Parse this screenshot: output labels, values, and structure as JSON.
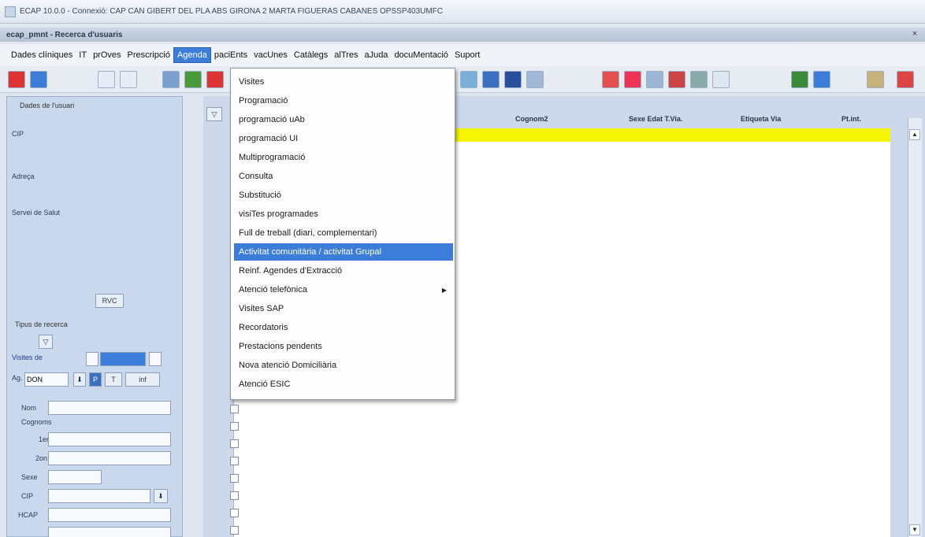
{
  "window": {
    "title": "ECAP 10.0.0 - Connexió: CAP CAN GIBERT DEL PLA    ABS GIRONA 2 MARTA FIGUERAS CABANES OPSSP403UMFC",
    "subtitle": "ecap_pmnt - Recerca d'usuaris",
    "close": "×"
  },
  "menubar": [
    {
      "label": "Dades clíniques"
    },
    {
      "label": "IT"
    },
    {
      "label": "prOves"
    },
    {
      "label": "Prescripció"
    },
    {
      "label": "Agenda",
      "active": true
    },
    {
      "label": "paciEnts"
    },
    {
      "label": "vacUnes"
    },
    {
      "label": "Catàlegs"
    },
    {
      "label": "alTres"
    },
    {
      "label": "aJuda"
    },
    {
      "label": "docuMentació"
    },
    {
      "label": "Suport"
    }
  ],
  "dropdown": {
    "items": [
      {
        "label": "Visites"
      },
      {
        "label": "Programació"
      },
      {
        "label": "programació uAb"
      },
      {
        "label": "programació UI"
      },
      {
        "label": "Multiprogramació"
      },
      {
        "label": "Consulta"
      },
      {
        "label": "Substitució"
      },
      {
        "label": "visiTes programades"
      },
      {
        "label": "Full de treball (diari, complementari)"
      },
      {
        "label": "Activitat comunitària / activitat Grupal",
        "selected": true
      },
      {
        "label": "Reinf. Agendes d'Extracció"
      },
      {
        "label": "Atenció telefònica",
        "submenu": true
      },
      {
        "label": "Visites SAP"
      },
      {
        "label": "Recordatoris"
      },
      {
        "label": "Prestacions pendents"
      },
      {
        "label": "Nova atenció Domiciliària"
      },
      {
        "label": "Atenció ESIC"
      }
    ]
  },
  "left_panel": {
    "group_user": "Dades de l'usuari",
    "cip_label": "CIP",
    "address_label": "Adreça",
    "health_service_label": "Servei de Salut",
    "rvc_button": "RVC",
    "group_search": "Tipus de recerca",
    "visits_label": "Visites de",
    "ag_label": "Ag.",
    "ag_value": "DON",
    "btn_p": "P",
    "btn_t": "T",
    "btn_inf": "inf",
    "nom_label": "Nom",
    "cognoms_label": "Cognoms",
    "ler_label": "1er",
    "lon_label": "2on",
    "sexe_label": "Sexe",
    "cip2_label": "CIP",
    "hcap_label": "HCAP"
  },
  "grid": {
    "headers": [
      {
        "label": "Cognom2"
      },
      {
        "label": "Sexe Edat T.Via."
      },
      {
        "label": "Etiqueta Via"
      },
      {
        "label": "Pt.int."
      }
    ]
  },
  "scroll": {
    "up": "▲",
    "down": "▼"
  }
}
